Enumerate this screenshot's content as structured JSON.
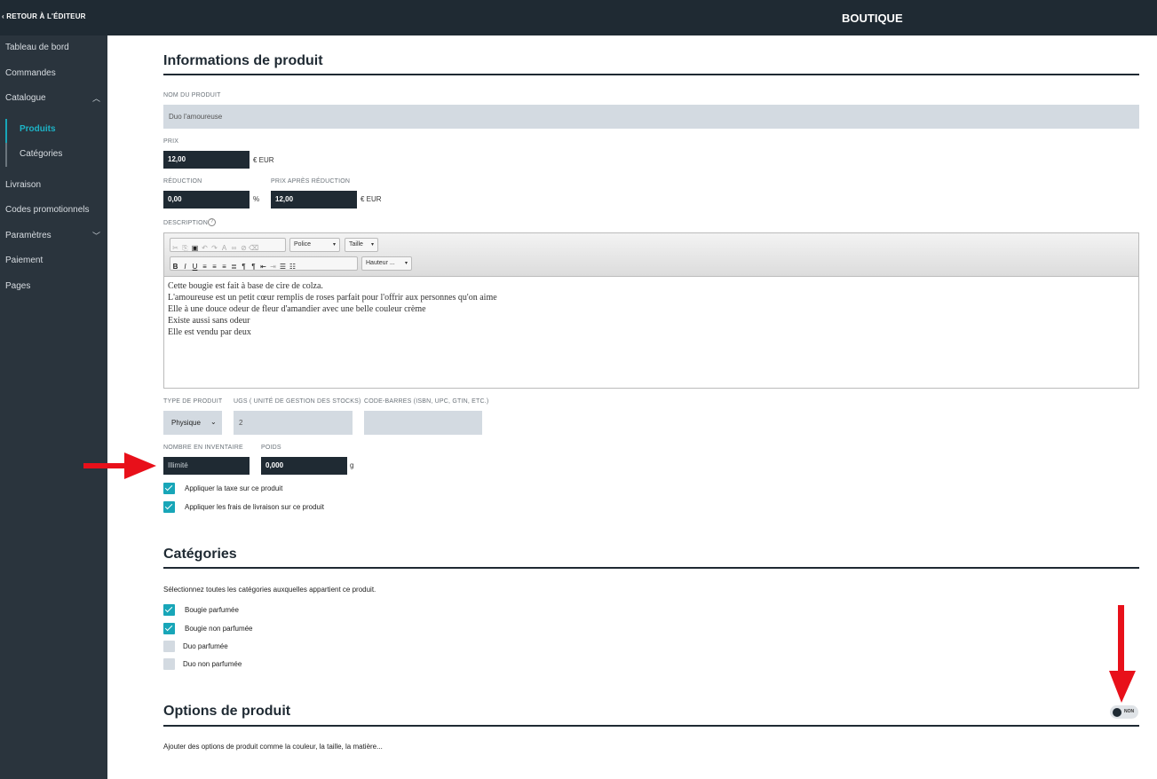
{
  "topbar": {
    "back_label": "RETOUR À L'ÉDITEUR",
    "app_title": "BOUTIQUE"
  },
  "sidebar": {
    "items": [
      {
        "label": "Tableau de bord"
      },
      {
        "label": "Commandes"
      },
      {
        "label": "Catalogue",
        "expanded": true
      },
      {
        "label": "Livraison"
      },
      {
        "label": "Codes promotionnels"
      },
      {
        "label": "Paramètres",
        "expanded": false
      },
      {
        "label": "Paiement"
      },
      {
        "label": "Pages"
      }
    ],
    "sub_items": [
      {
        "label": "Produits",
        "active": true
      },
      {
        "label": "Catégories",
        "active": false
      }
    ]
  },
  "product_info": {
    "title": "Informations de produit",
    "name_label": "NOM DU PRODUIT",
    "name_value": "Duo l'amoureuse",
    "price_label": "PRIX",
    "price_value": "12,00",
    "price_unit": "€ EUR",
    "discount_label": "RÉDUCTION",
    "discount_value": "0,00",
    "discount_unit": "%",
    "final_price_label": "PRIX APRÈS RÉDUCTION",
    "final_price_value": "12,00",
    "final_price_unit": "€ EUR",
    "description_label": "DESCRIPTION",
    "editor": {
      "font_combo": "Police",
      "size_combo": "Taille",
      "height_combo": "Hauteur ...",
      "lines": [
        "Cette bougie est fait à base de cire de colza.",
        "L'amoureuse est un petit cœur remplis de roses parfait pour l'offrir aux personnes qu'on aime",
        "Elle à une douce odeur de fleur d'amandier avec une belle couleur crème",
        "Existe aussi sans odeur",
        "Elle est vendu par deux"
      ]
    },
    "type_label": "TYPE DE PRODUIT",
    "type_value": "Physique",
    "sku_label": "UGS ( UNITÉ DE GESTION DES STOCKS)",
    "sku_value": "2",
    "barcode_label": "CODE-BARRES (ISBN, UPC, GTIN, ETC.)",
    "barcode_value": "",
    "inventory_label": "NOMBRE EN INVENTAIRE",
    "inventory_placeholder": "Illimité",
    "weight_label": "POIDS",
    "weight_value": "0,000",
    "weight_unit": "g",
    "tax_checkbox": {
      "label": "Appliquer la taxe sur ce produit",
      "checked": true
    },
    "shipping_checkbox": {
      "label": "Appliquer les frais de livraison sur ce produit",
      "checked": true
    }
  },
  "categories": {
    "title": "Catégories",
    "intro": "Sélectionnez toutes les catégories auxquelles appartient ce produit.",
    "items": [
      {
        "label": "Bougie parfumée",
        "checked": true
      },
      {
        "label": "Bougie non parfumée",
        "checked": true
      },
      {
        "label": "Duo parfumée",
        "checked": false
      },
      {
        "label": "Duo non parfumée",
        "checked": false
      }
    ]
  },
  "options": {
    "title": "Options de produit",
    "toggle_label": "NON",
    "toggle_on": false,
    "description": "Ajouter des options de produit comme la couleur, la taille, la matière..."
  },
  "colors": {
    "accent": "#18a6b8",
    "dark": "#1f2a33",
    "sidebar": "#2a343d",
    "annotation": "#e8101a"
  }
}
